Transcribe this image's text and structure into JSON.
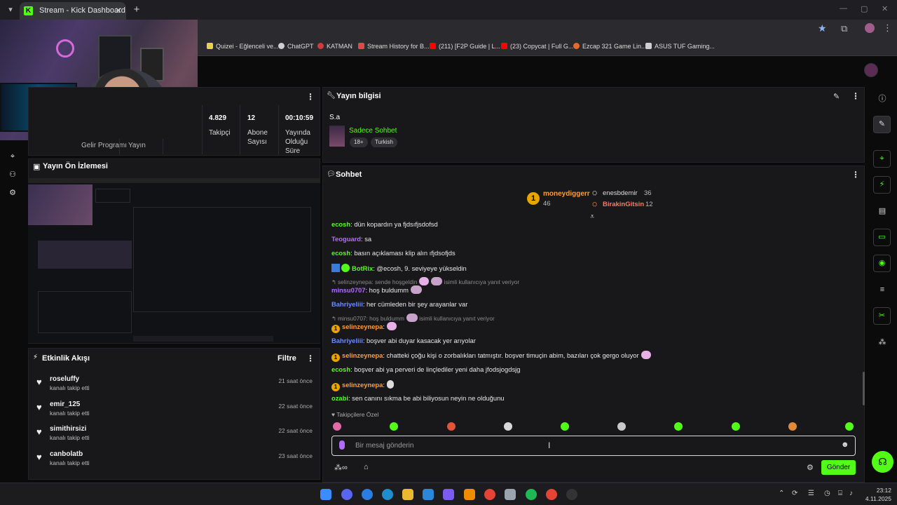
{
  "browser": {
    "tab_title": "Stream - Kick Dashboard",
    "tab_icon": "kick-icon",
    "tab_icon_glyph": "K",
    "tab_menu_icon": "chevron-down-icon",
    "close_icon": "close-icon",
    "new_tab_icon": "plus-icon",
    "bookmarks": [
      {
        "label": "Quizei - Eğlenceli ve...",
        "color": "#e8d24a"
      },
      {
        "label": "ChatGPT",
        "color": "#cfcfcf"
      },
      {
        "label": "KATMAN",
        "color": "#d23b3b"
      },
      {
        "label": "Stream History for B...",
        "color": "#e2484a"
      },
      {
        "label": "(211) [F2P Guide | L...",
        "color": "#ff0000"
      },
      {
        "label": "(23) Copycat | Full G...",
        "color": "#ff0000"
      },
      {
        "label": "Ezcap 321 Game Lin...",
        "color": "#e26a2c"
      },
      {
        "label": "ASUS TUF Gaming...",
        "color": "#cfcfcf"
      }
    ]
  },
  "stats": {
    "partial_labels": [
      "Gelir Programı",
      "Yayın"
    ],
    "items": [
      {
        "value": "4.829",
        "label": "Takipçi"
      },
      {
        "value": "12",
        "label": "Abone Sayısı"
      },
      {
        "value": "00:10:59",
        "label": "Yayında Olduğu Süre"
      }
    ]
  },
  "preview": {
    "title": "Yayın Ön İzlemesi"
  },
  "activity": {
    "title": "Etkinlik Akışı",
    "filter": "Filtre",
    "items": [
      {
        "name": "roseluffy",
        "action": "kanalı takip etti",
        "time": "21 saat önce"
      },
      {
        "name": "emir_125",
        "action": "kanalı takip etti",
        "time": "22 saat önce"
      },
      {
        "name": "simithirsizi",
        "action": "kanalı takip etti",
        "time": "22 saat önce"
      },
      {
        "name": "canbolatb",
        "action": "kanalı takip etti",
        "time": "23 saat önce"
      }
    ]
  },
  "stream_info": {
    "title": "Yayın bilgisi",
    "stream_title": "S.a",
    "category": "Sadece Sohbet",
    "tags": [
      "18+",
      "Turkish"
    ]
  },
  "chat": {
    "title": "Sohbet",
    "leaderboard": [
      {
        "rank": "1",
        "name": "moneydiggerr",
        "count": "46"
      },
      {
        "name": "enesbdemir",
        "count": "36"
      },
      {
        "name": "BirakinGitsin",
        "count": "12"
      }
    ],
    "messages": [
      {
        "user": "ecosh",
        "color": "#53fc18",
        "text": ": dün kopardın ya fjdsıfjsdofsd"
      },
      {
        "user": "Teoguard",
        "color": "#b36bff",
        "text": ": sa"
      },
      {
        "user": "ecosh",
        "color": "#53fc18",
        "text": ": basın açıklaması klip alın ıfjdsofjds"
      },
      {
        "user": "BotRix",
        "color": "#53fc18",
        "text": ": @ecosh, 9. seviyeye yükseldin"
      },
      {
        "reply": "selinzeynepa: sende hoşgeldin",
        "reply_suffix": "isimli kullanıcıya yanıt veriyor"
      },
      {
        "user": "minsu0707",
        "color": "#b36bff",
        "text": ": hoş buldumm"
      },
      {
        "user": "Bahriyeliii",
        "color": "#6b8cff",
        "text": ": her cümleden bir şey arayanlar var"
      },
      {
        "reply": "minsu0707: hoş buldumm",
        "reply_suffix": "isimli kullanıcıya yanıt veriyor"
      },
      {
        "user": "selinzeynepa",
        "color": "#ff9d3d",
        "text": ":",
        "badge": "1"
      },
      {
        "user": "Bahriyeliii",
        "color": "#6b8cff",
        "text": ": boşver abi duyar kasacak yer arıyolar"
      },
      {
        "user": "selinzeynepa",
        "color": "#ff9d3d",
        "text": ": chatteki çoğu kişi o zorbalıkları tatmıştır. boşver timuçin abim, bazıları çok gergo oluyor",
        "badge": "1"
      },
      {
        "user": "ecosh",
        "color": "#53fc18",
        "text": ": boşver abi ya perveri de linçlediler yeni daha jfodsjogdsjg"
      },
      {
        "user": "selinzeynepa",
        "color": "#ff9d3d",
        "text": ":",
        "badge": "1"
      },
      {
        "user": "ozabi",
        "color": "#53fc18",
        "text": ": sen canını sıkma be abi biliyosun neyin ne olduğunu"
      }
    ],
    "followers_only": "Takipçilere Özel",
    "input_placeholder": "Bir mesaj gönderin",
    "send": "Gönder"
  },
  "taskbar": {
    "time": "23:12",
    "date": "4.11.2025"
  }
}
